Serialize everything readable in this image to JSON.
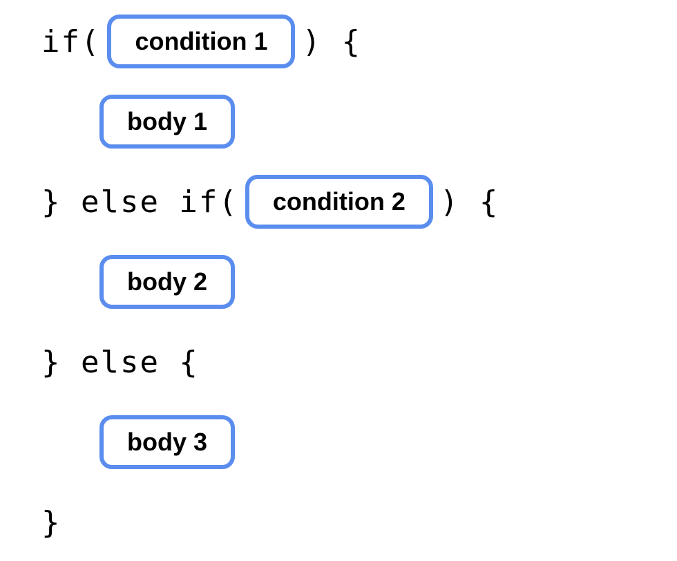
{
  "diagram": {
    "line1": {
      "keyword_if": "if(",
      "slot_condition1": "condition 1",
      "close_paren_brace": ") {"
    },
    "line2": {
      "slot_body1": "body 1"
    },
    "line3": {
      "keyword_else_if": "} else if(",
      "slot_condition2": "condition 2",
      "close_paren_brace": ") {"
    },
    "line4": {
      "slot_body2": "body 2"
    },
    "line5": {
      "keyword_else": "} else {"
    },
    "line6": {
      "slot_body3": "body 3"
    },
    "line7": {
      "close_brace": "}"
    }
  }
}
